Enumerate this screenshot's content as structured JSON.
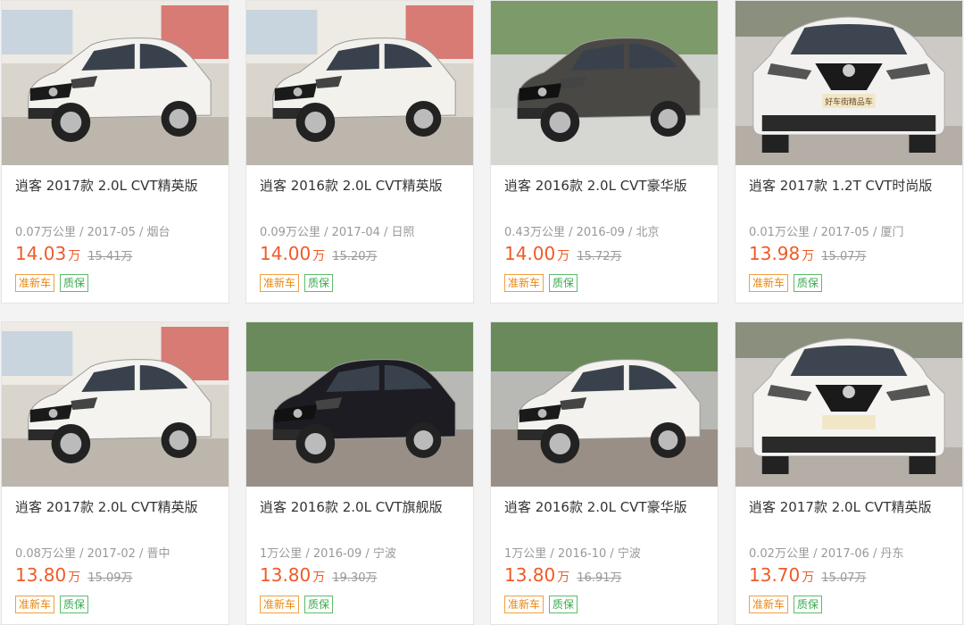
{
  "listings": [
    {
      "title": "逍客 2017款 2.0L CVT精英版",
      "meta": "0.07万公里 / 2017-05 / 烟台",
      "price": "14.03",
      "unit": "万",
      "original_price": "15.41万",
      "tags": [
        "准新车",
        "质保"
      ],
      "car_color": "#f4f2ee",
      "scene": "showroom",
      "plate_text": ""
    },
    {
      "title": "逍客 2016款 2.0L CVT精英版",
      "meta": "0.09万公里 / 2017-04 / 日照",
      "price": "14.00",
      "unit": "万",
      "original_price": "15.20万",
      "tags": [
        "准新车",
        "质保"
      ],
      "car_color": "#f3f1ec",
      "scene": "showroom",
      "plate_text": ""
    },
    {
      "title": "逍客 2016款 2.0L CVT豪华版",
      "meta": "0.43万公里 / 2016-09 / 北京",
      "price": "14.00",
      "unit": "万",
      "original_price": "15.72万",
      "tags": [
        "准新车",
        "质保"
      ],
      "car_color": "#4a4844",
      "scene": "outdoor",
      "plate_text": ""
    },
    {
      "title": "逍客 2017款 1.2T CVT时尚版",
      "meta": "0.01万公里 / 2017-05 / 厦门",
      "price": "13.98",
      "unit": "万",
      "original_price": "15.07万",
      "tags": [
        "准新车",
        "质保"
      ],
      "car_color": "#f2f1ef",
      "scene": "front",
      "plate_text": "好车街精品车"
    },
    {
      "title": "逍客 2017款 2.0L CVT精英版",
      "meta": "0.08万公里 / 2017-02 / 晋中",
      "price": "13.80",
      "unit": "万",
      "original_price": "15.09万",
      "tags": [
        "准新车",
        "质保"
      ],
      "car_color": "#f4f3ef",
      "scene": "showroom",
      "plate_text": ""
    },
    {
      "title": "逍客 2016款 2.0L CVT旗舰版",
      "meta": "1万公里 / 2016-09 / 宁波",
      "price": "13.80",
      "unit": "万",
      "original_price": "19.30万",
      "tags": [
        "准新车",
        "质保"
      ],
      "car_color": "#1c1c22",
      "scene": "street",
      "plate_text": ""
    },
    {
      "title": "逍客 2016款 2.0L CVT豪华版",
      "meta": "1万公里 / 2016-10 / 宁波",
      "price": "13.80",
      "unit": "万",
      "original_price": "16.91万",
      "tags": [
        "准新车",
        "质保"
      ],
      "car_color": "#f3f2ee",
      "scene": "street",
      "plate_text": ""
    },
    {
      "title": "逍客 2017款 2.0L CVT精英版",
      "meta": "0.02万公里 / 2017-06 / 丹东",
      "price": "13.70",
      "unit": "万",
      "original_price": "15.07万",
      "tags": [
        "准新车",
        "质保"
      ],
      "car_color": "#f5f4f1",
      "scene": "front",
      "plate_text": ""
    }
  ]
}
